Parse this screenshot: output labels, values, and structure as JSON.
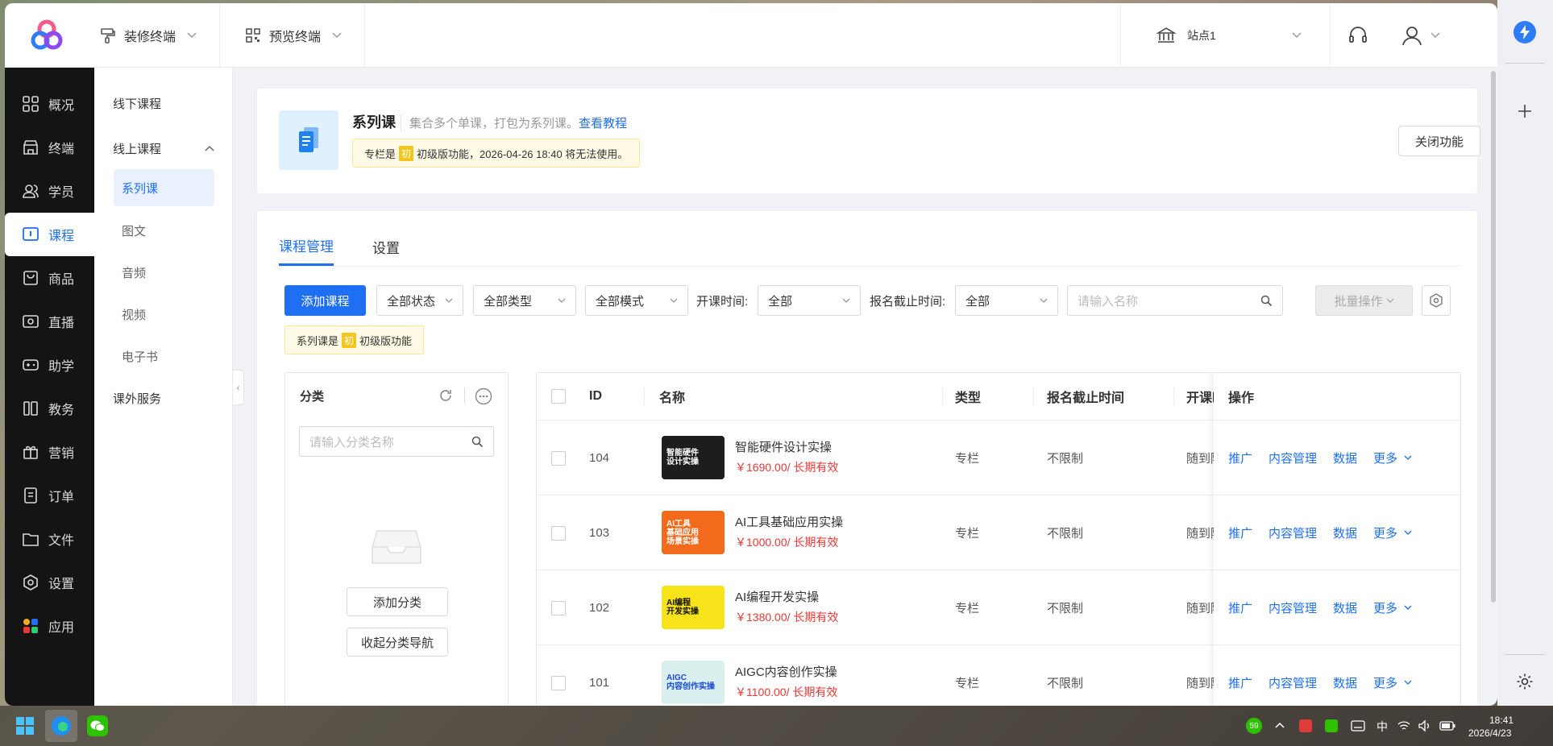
{
  "topbar": {
    "decorate_label": "装修终端",
    "preview_label": "预览终端",
    "site_label": "站点1"
  },
  "leftnav": [
    {
      "label": "概况",
      "icon": "grid-icon"
    },
    {
      "label": "终端",
      "icon": "store-icon"
    },
    {
      "label": "学员",
      "icon": "users-icon"
    },
    {
      "label": "课程",
      "icon": "course-icon"
    },
    {
      "label": "商品",
      "icon": "bag-icon"
    },
    {
      "label": "直播",
      "icon": "live-icon"
    },
    {
      "label": "助学",
      "icon": "gamepad-icon"
    },
    {
      "label": "教务",
      "icon": "book-icon"
    },
    {
      "label": "营销",
      "icon": "gift-icon"
    },
    {
      "label": "订单",
      "icon": "order-icon"
    },
    {
      "label": "文件",
      "icon": "folder-icon"
    },
    {
      "label": "设置",
      "icon": "settings-icon"
    },
    {
      "label": "应用",
      "icon": "apps-icon"
    }
  ],
  "subnav": {
    "offline": "线下课程",
    "online": "线上课程",
    "children": [
      "系列课",
      "图文",
      "音频",
      "视频",
      "电子书"
    ],
    "extra": "课外服务"
  },
  "feature": {
    "title": "系列课",
    "desc": "集合多个单课，打包为系列课。",
    "tutorial": "查看教程",
    "notice_pre": "专栏是",
    "badge": "初",
    "notice_post": "初级版功能，2026-04-26 18:40 将无法使用。",
    "close_btn": "关闭功能"
  },
  "tabs": [
    "课程管理",
    "设置"
  ],
  "filters": {
    "add_btn": "添加课程",
    "status": "全部状态",
    "type": "全部类型",
    "mode": "全部模式",
    "start_label": "开课时间:",
    "start_value": "全部",
    "deadline_label": "报名截止时间:",
    "deadline_value": "全部",
    "search_placeholder": "请输入名称",
    "batch_btn": "批量操作",
    "series_pre": "系列课是",
    "series_badge": "初",
    "series_post": "初级版功能"
  },
  "category": {
    "title": "分类",
    "search_placeholder": "请输入分类名称",
    "add_btn": "添加分类",
    "collapse_btn": "收起分类导航"
  },
  "table": {
    "headers": {
      "id": "ID",
      "name": "名称",
      "type": "类型",
      "deadline": "报名截止时间",
      "start": "开课时",
      "ops": "操作"
    },
    "ops": {
      "promote": "推广",
      "content": "内容管理",
      "data": "数据",
      "more": "更多"
    },
    "rows": [
      {
        "id": "104",
        "name": "智能硬件设计实操",
        "price": "￥1690.00/ 长期有效",
        "type": "专栏",
        "deadline": "不限制",
        "start": "随到随",
        "thumb_text": "智能硬件\n设计实操"
      },
      {
        "id": "103",
        "name": "AI工具基础应用实操",
        "price": "￥1000.00/ 长期有效",
        "type": "专栏",
        "deadline": "不限制",
        "start": "随到随",
        "thumb_text": "AI工具\n基础应用\n场景实操"
      },
      {
        "id": "102",
        "name": "AI编程开发实操",
        "price": "￥1380.00/ 长期有效",
        "type": "专栏",
        "deadline": "不限制",
        "start": "随到随",
        "thumb_text": "AI编程\n开发实操"
      },
      {
        "id": "101",
        "name": "AIGC内容创作实操",
        "price": "￥1100.00/ 长期有效",
        "type": "专栏",
        "deadline": "不限制",
        "start": "随到随",
        "thumb_text": "AIGC\n内容创作实操"
      }
    ]
  },
  "taskbar": {
    "temp_badge": "59",
    "ime": "中",
    "time": "18:41",
    "date": "2026/4/23"
  },
  "colors": {
    "accent": "#1f6ff2",
    "price": "#e53935",
    "nav_bg": "#141414"
  }
}
